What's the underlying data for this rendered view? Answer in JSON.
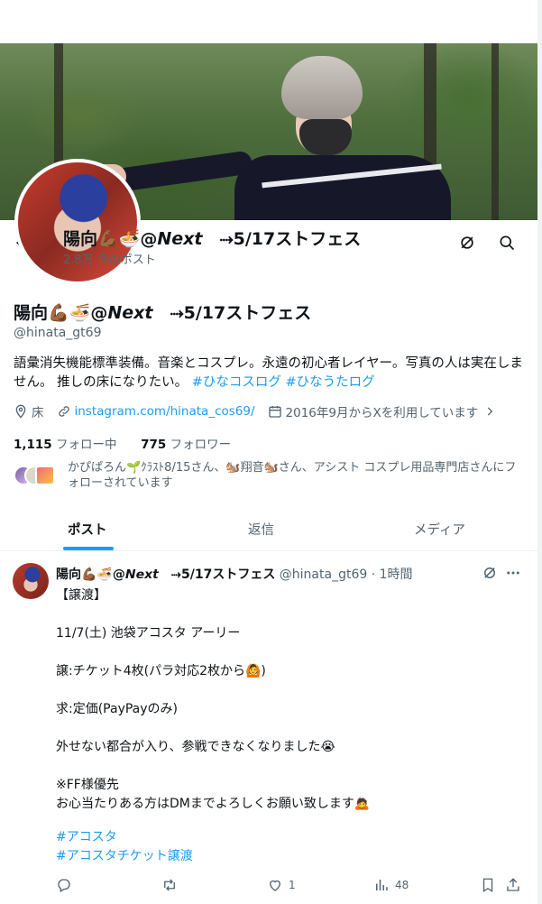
{
  "header": {
    "name": "陽向💪🏾🍜@𝙉𝙚𝙭𝙩　⤑5/17ストフェス",
    "post_count": "2.8万 件のポスト"
  },
  "profile": {
    "name": "陽向💪🏾🍜@𝙉𝙚𝙭𝙩　⤑5/17ストフェス",
    "handle": "@hinata_gt69",
    "bio_text": "語彙消失機能標準装備。音楽とコスプレ。永遠の初心者レイヤー。写真の人は実在しません。 推しの床になりたい。",
    "bio_tag1": "#ひなコスログ",
    "bio_tag2": "#ひなうたログ",
    "location": "床",
    "link": "instagram.com/hinata_cos69/",
    "joined": "2016年9月からXを利用しています",
    "following_count": "1,115",
    "following_label": "フォロー中",
    "followers_count": "775",
    "followers_label": "フォロワー",
    "followed_by": "かぴぱろん🌱ｸﾗｽﾄ8/15さん、🐿️翔音🐿️さん、アシスト コスプレ用品専門店さんにフォローされています"
  },
  "tabs": [
    "ポスト",
    "返信",
    "メディア"
  ],
  "tweet": {
    "name": "陽向💪🏾🍜@𝙉𝙚𝙭𝙩　⤑5/17ストフェス",
    "handle": "@hinata_gt69",
    "time": "· 1時間",
    "body": "【譲渡】\n\n11/7(土) 池袋アコスタ アーリー\n\n譲:チケット4枚(パラ対応2枚から🙆)\n\n求:定価(PayPayのみ)\n\n外せない都合が入り、参戦できなくなりました😭\n\n※FF様優先\nお心当たりある方はDMまでよろしくお願い致します🙇",
    "tags": [
      "#アコスタ",
      "#アコスタチケット譲渡"
    ],
    "likes": "1",
    "views": "48"
  },
  "colors": {
    "accent": "#1d9bf0",
    "secondary_text": "#536471"
  }
}
